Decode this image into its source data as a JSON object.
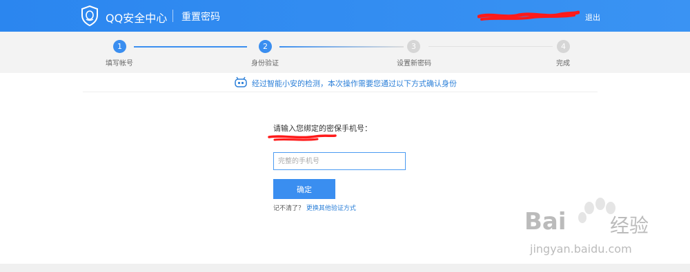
{
  "header": {
    "brand": "QQ安全中心",
    "page_name": "重置密码",
    "logout": "退出",
    "user_redacted": true
  },
  "steps": [
    {
      "num": "1",
      "label": "填写帐号",
      "state": "done"
    },
    {
      "num": "2",
      "label": "身份验证",
      "state": "active"
    },
    {
      "num": "3",
      "label": "设置新密码",
      "state": "pending"
    },
    {
      "num": "4",
      "label": "完成",
      "state": "pending"
    }
  ],
  "notice": {
    "text": "经过智能小安的检测，本次操作需要您通过以下方式确认身份",
    "icon": "robot-icon"
  },
  "form": {
    "prompt": "请输入您绑定的密保手机号：",
    "phone_placeholder": "完整的手机号",
    "phone_value": "",
    "confirm_label": "确定",
    "forgot_text": "记不清了？",
    "other_method_link": "更换其他验证方式"
  },
  "watermark": {
    "brand": "Bai",
    "brand_cn": "经验",
    "url": "jingyan.baidu.com"
  },
  "colors": {
    "primary": "#2f8cf0",
    "link": "#2b7fd8",
    "pending": "#d6d6d6",
    "redact": "#ff1a1a"
  }
}
